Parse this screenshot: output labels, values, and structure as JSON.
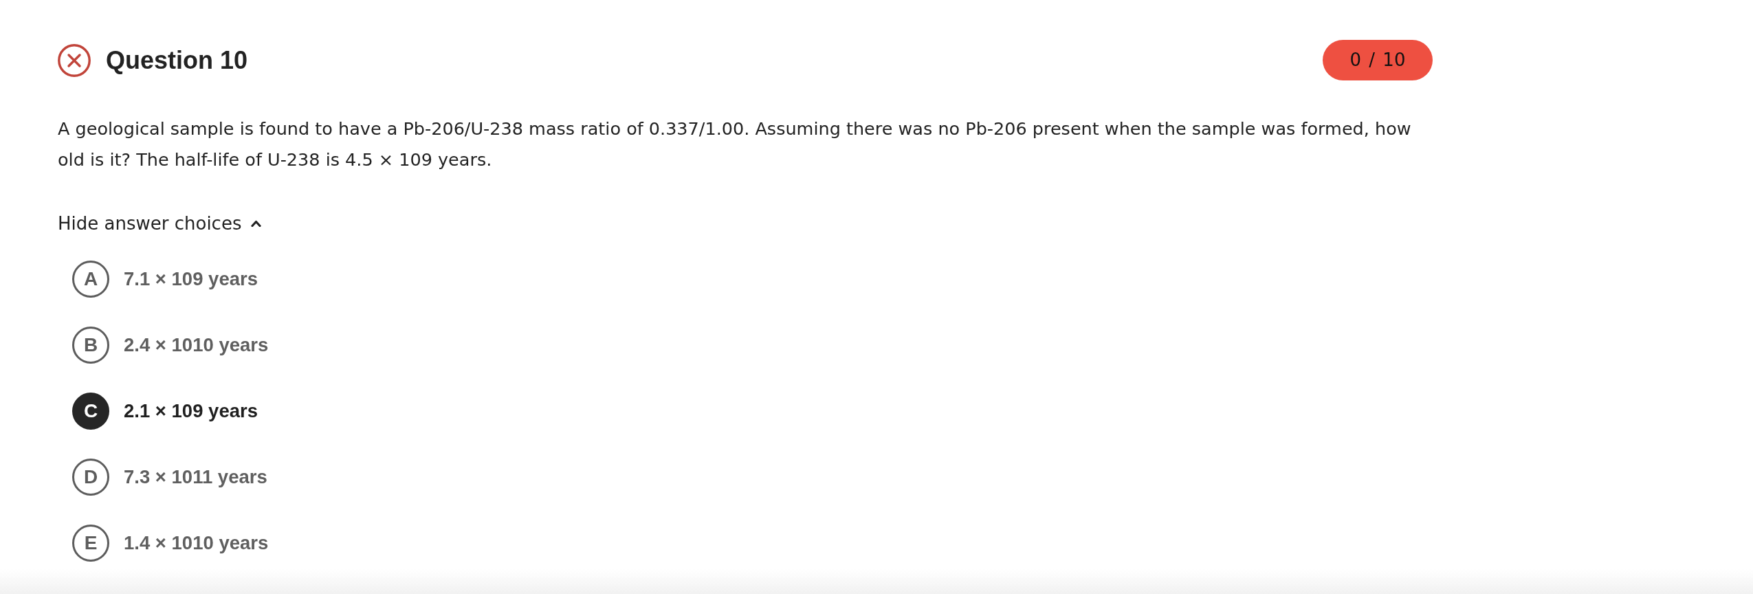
{
  "question": {
    "correct": false,
    "title": "Question 10",
    "score": "0 / 10",
    "text": "A geological sample is found to have a Pb-206/U-238 mass ratio of 0.337/1.00. Assuming there was no Pb-206 present when the sample was formed, how old is it? The half-life of U-238 is 4.5 × 109 years."
  },
  "toggle": {
    "label": "Hide answer choices",
    "expanded": true
  },
  "choices": [
    {
      "letter": "A",
      "text": "7.1 × 109 years",
      "selected": false
    },
    {
      "letter": "B",
      "text": "2.4 × 1010 years",
      "selected": false
    },
    {
      "letter": "C",
      "text": "2.1 × 109 years",
      "selected": true
    },
    {
      "letter": "D",
      "text": "7.3 × 1011 years",
      "selected": false
    },
    {
      "letter": "E",
      "text": "1.4 × 1010 years",
      "selected": false
    }
  ]
}
